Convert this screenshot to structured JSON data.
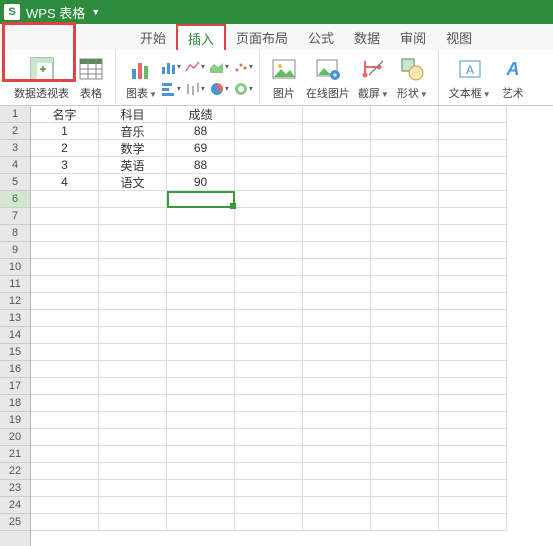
{
  "app": {
    "name": "WPS 表格"
  },
  "menu": {
    "items": [
      "开始",
      "插入",
      "页面布局",
      "公式",
      "数据",
      "审阅",
      "视图"
    ],
    "activeIndex": 1
  },
  "ribbon": {
    "pivot": "数据透视表",
    "table": "表格",
    "chart": "图表",
    "picture": "图片",
    "onlinePic": "在线图片",
    "screenshot": "截屏",
    "shape": "形状",
    "textbox": "文本框",
    "art": "艺术"
  },
  "sheet": {
    "rows": 25,
    "selectedRow": 6,
    "selectedCol": "C",
    "data": [
      [
        "名字",
        "科目",
        "成绩"
      ],
      [
        "1",
        "音乐",
        "88"
      ],
      [
        "2",
        "数学",
        "69"
      ],
      [
        "3",
        "英语",
        "88"
      ],
      [
        "4",
        "语文",
        "90"
      ]
    ]
  }
}
